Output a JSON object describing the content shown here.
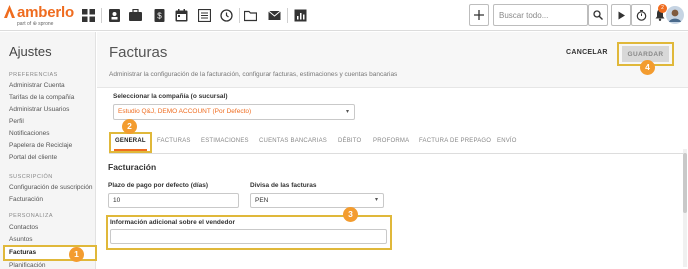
{
  "brand": {
    "name": "amberlo",
    "sub": "part of ⊕ sprone"
  },
  "topbar": {
    "icons": [
      "dashboard-icon",
      "contacts-icon",
      "briefcase-icon",
      "invoice-icon",
      "calendar-icon",
      "tasks-icon",
      "timer-history-icon",
      "folder-icon",
      "mail-icon",
      "reports-icon"
    ],
    "add_icon": "plus-icon",
    "search_placeholder": "Buscar todo...",
    "notifications_count": "2"
  },
  "sidebar": {
    "title": "Ajustes",
    "sections": [
      {
        "label": "PREFERENCIAS",
        "items": [
          "Administrar Cuenta",
          "Tarifas de la compañía",
          "Administrar Usuarios",
          "Perfil",
          "Notificaciones",
          "Papelera de Reciclaje",
          "Portal del cliente"
        ]
      },
      {
        "label": "SUSCRIPCIÓN",
        "items": [
          "Configuración de suscripción",
          "Facturación"
        ]
      },
      {
        "label": "PERSONALIZA",
        "items": [
          "Contactos",
          "Asuntos",
          "Facturas",
          "Planificación"
        ]
      }
    ],
    "active": "Facturas"
  },
  "page": {
    "title": "Facturas",
    "description": "Administrar la configuración de la facturación, configurar facturas, estimaciones y cuentas bancarias",
    "cancel_label": "CANCELAR",
    "save_label": "GUARDAR"
  },
  "company": {
    "label": "Seleccionar la compañía (o sucursal)",
    "value": "Estudio Q&J, DEMO ACCOUNT (Por Defecto)"
  },
  "tabs": [
    "GENERAL",
    "FACTURAS",
    "ESTIMACIONES",
    "CUENTAS BANCARIAS",
    "DÉBITO",
    "PROFORMA",
    "FACTURA DE PREPAGO",
    "ENVÍO"
  ],
  "billing": {
    "section_title": "Facturación",
    "term_label": "Plazo de pago por defecto (días)",
    "term_value": "10",
    "currency_label": "Divisa de las facturas",
    "currency_value": "PEN",
    "vendor_info_label": "Información adicional sobre el vendedor",
    "vendor_info_value": ""
  },
  "steps": [
    "1",
    "2",
    "3",
    "4"
  ],
  "colors": {
    "accent": "#ef6c1f",
    "highlight": "#e0b83a",
    "step": "#f39c2f"
  }
}
